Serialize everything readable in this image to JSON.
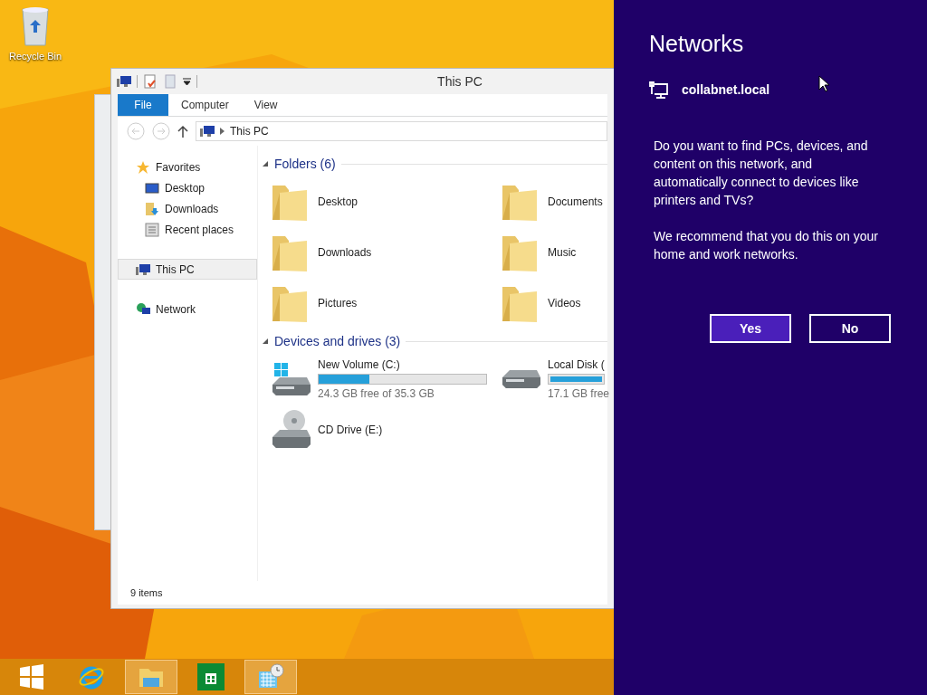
{
  "desktop": {
    "icons": [
      {
        "label": "Recycle Bin"
      }
    ]
  },
  "explorer": {
    "title": "This PC",
    "ribbon_tabs": [
      {
        "label": "File",
        "selected": true
      },
      {
        "label": "Computer",
        "selected": false
      },
      {
        "label": "View",
        "selected": false
      }
    ],
    "address": "This PC",
    "nav": [
      {
        "label": "Favorites",
        "kind": "favorites",
        "selected": false,
        "children": [
          {
            "label": "Desktop",
            "kind": "desktop",
            "selected": false
          },
          {
            "label": "Downloads",
            "kind": "downloads",
            "selected": false
          },
          {
            "label": "Recent places",
            "kind": "recent",
            "selected": false
          }
        ]
      },
      {
        "label": "This PC",
        "kind": "pc",
        "selected": true
      },
      {
        "label": "Network",
        "kind": "network",
        "selected": false
      }
    ],
    "groups": [
      {
        "title": "Folders (6)",
        "expanded": true,
        "items": [
          {
            "kind": "folder",
            "name": "Desktop"
          },
          {
            "kind": "folder",
            "name": "Documents"
          },
          {
            "kind": "folder",
            "name": "Downloads"
          },
          {
            "kind": "folder",
            "name": "Music"
          },
          {
            "kind": "folder",
            "name": "Pictures"
          },
          {
            "kind": "folder",
            "name": "Videos"
          }
        ]
      },
      {
        "title": "Devices and drives (3)",
        "expanded": true,
        "items": [
          {
            "kind": "system_drive",
            "name": "New Volume (C:)",
            "level": 0.3,
            "detail": "24.3 GB free of 35.3 GB"
          },
          {
            "kind": "drive",
            "name": "Local Disk (",
            "level": 1,
            "detail": "17.1 GB free"
          },
          {
            "kind": "cd",
            "name": "CD Drive (E:)"
          }
        ]
      }
    ],
    "status_bar": "9 items"
  },
  "networks": {
    "title": "Networks",
    "network": "collabnet.local",
    "message": "Do you want to find PCs, devices, and content on this network, and automatically connect to devices like printers and TVs?",
    "recommendation": "We recommend that you do this on your home and work networks.",
    "buttons": [
      {
        "label": "Yes",
        "selected": true
      },
      {
        "label": "No",
        "selected": false
      }
    ]
  },
  "taskbar": {
    "items": [
      {
        "kind": "start",
        "open": false
      },
      {
        "kind": "browser",
        "open": false
      },
      {
        "kind": "files",
        "open": true
      },
      {
        "kind": "store",
        "open": false
      },
      {
        "kind": "calendar",
        "open": true
      }
    ]
  }
}
